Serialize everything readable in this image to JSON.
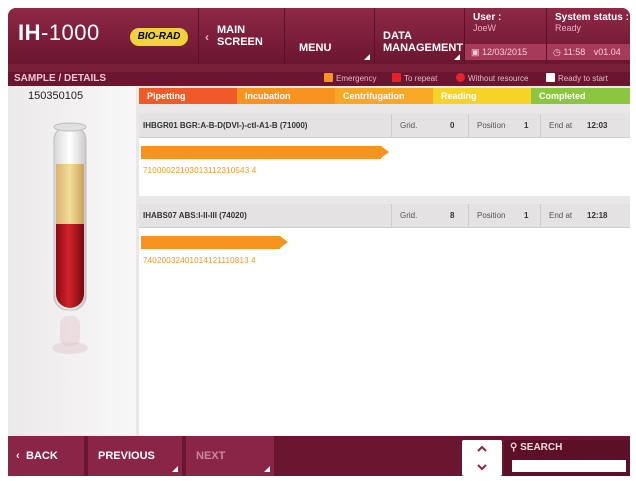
{
  "header": {
    "logo_bold": "IH",
    "logo_model": "-1000",
    "brand": "BIO-RAD",
    "main_screen_line1": "MAIN",
    "main_screen_line2": "SCREEN",
    "menu_label": "MENU",
    "data_line1": "DATA",
    "data_line2": "MANAGEMENT",
    "user_label": "User :",
    "user_value": "JoeW",
    "date": "12/03/2015",
    "status_label": "System status :",
    "status_value": "Ready",
    "time": "11:58",
    "version": "v01.04"
  },
  "sample": {
    "title": "SAMPLE / DETAILS",
    "id": "150350105",
    "legend": [
      "Emergency",
      "To repeat",
      "Without resource",
      "Ready to start"
    ],
    "legend_colors": [
      "#f7931e",
      "#e8202a",
      "#e8202a",
      "#ffffff"
    ]
  },
  "steps": [
    {
      "label": "Pipetting",
      "color": "#f05a28"
    },
    {
      "label": "Incubation",
      "color": "#f7931e"
    },
    {
      "label": "Centrifugation",
      "color": "#f9a825"
    },
    {
      "label": "Reading",
      "color": "#f5d327"
    },
    {
      "label": "Completed",
      "color": "#8cc63f"
    }
  ],
  "tests": [
    {
      "name": "IHBGR01 BGR:A-B-D(DVI-)-ctl-A1-B (71000)",
      "grid_label": "Grid.",
      "grid": "0",
      "position_label": "Position",
      "position": "1",
      "end_label": "End at",
      "end": "12:03",
      "progress": 0.5,
      "barcode": "71000022103013112310543 4"
    },
    {
      "name": "IHABS07 ABS:I-II-III (74020)",
      "grid_label": "Grid.",
      "grid": "8",
      "position_label": "Position",
      "position": "1",
      "end_label": "End at",
      "end": "12:18",
      "progress": 0.29,
      "barcode": "74020032401014121110813 4"
    }
  ],
  "footer": {
    "back": "BACK",
    "previous": "PREVIOUS",
    "next": "NEXT",
    "search": "SEARCH"
  }
}
